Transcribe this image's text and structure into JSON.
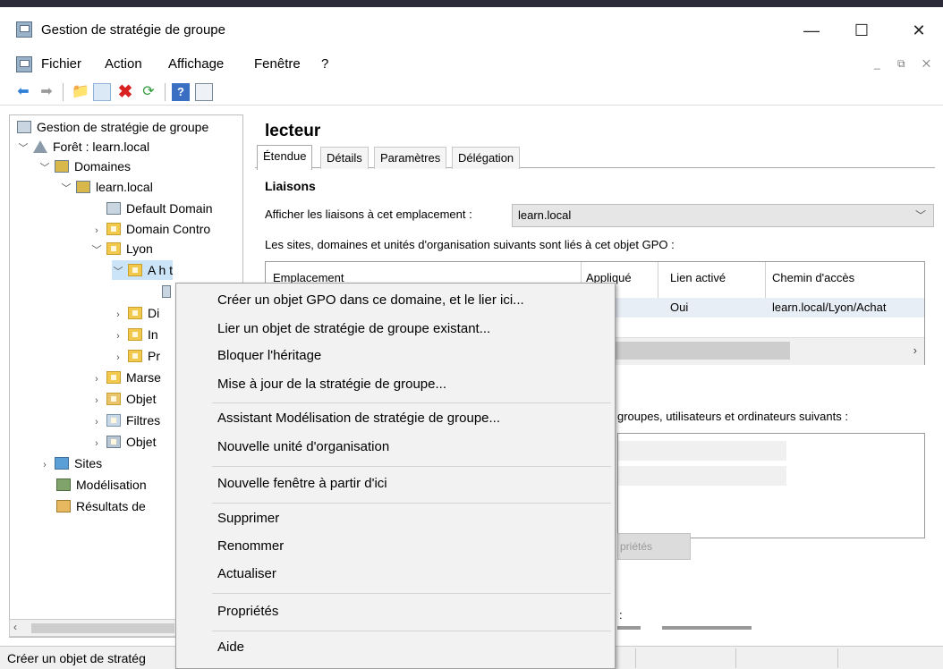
{
  "window": {
    "title": "Gestion de stratégie de groupe",
    "minimize": "—",
    "maximize": "☐",
    "close": "✕"
  },
  "menubar": {
    "items": [
      "Fichier",
      "Action",
      "Affichage",
      "Fenêtre",
      "?"
    ],
    "mdi_controls": "_ ⧉ ✕"
  },
  "toolbar": {
    "icons": [
      "back-arrow",
      "forward-arrow",
      "up-folder",
      "console-tree",
      "delete",
      "refresh",
      "help",
      "view"
    ]
  },
  "tree": {
    "root": "Gestion de stratégie de groupe",
    "forest": "Forêt : learn.local",
    "domains": "Domaines",
    "domain": "learn.local",
    "default_domain": "Default Domain",
    "domain_controllers": "Domain Contro",
    "lyon": "Lyon",
    "achat": "A  h t",
    "di": "Di",
    "in": "In",
    "pr": "Pr",
    "marse": "Marse",
    "objet1": "Objet",
    "filtres": "Filtres",
    "objet2": "Objet",
    "sites": "Sites",
    "modelisation": "Modélisation",
    "resultats": "Résultats de"
  },
  "details": {
    "gpo_name": "lecteur",
    "tabs": [
      "Étendue",
      "Détails",
      "Paramètres",
      "Délégation"
    ],
    "liaisons_heading": "Liaisons",
    "afficher_label": "Afficher les liaisons à cet emplacement :",
    "afficher_value": "learn.local",
    "linked_text": "Les sites, domaines et unités d'organisation suivants sont liés à cet objet GPO :",
    "columns": [
      "Emplacement",
      "Appliqué",
      "Lien activé",
      "Chemin d'accès"
    ],
    "row": {
      "lien": "Oui",
      "chemin": "learn.local/Lyon/Achat"
    },
    "filter_text": "groupes, utilisateurs et ordinateurs suivants :",
    "proprietes_btn": "priétés",
    "partial_colon": ":"
  },
  "context_menu": {
    "items": [
      "Créer un objet GPO dans ce domaine, et le lier ici...",
      "Lier un objet de stratégie de groupe existant...",
      "Bloquer l'héritage",
      "Mise à jour de la stratégie de groupe...",
      "Assistant Modélisation de stratégie de groupe...",
      "Nouvelle unité d'organisation",
      "Nouvelle fenêtre à partir d'ici",
      "Supprimer",
      "Renommer",
      "Actualiser",
      "Propriétés",
      "Aide"
    ]
  },
  "statusbar": {
    "text": "Créer un objet de stratég"
  }
}
